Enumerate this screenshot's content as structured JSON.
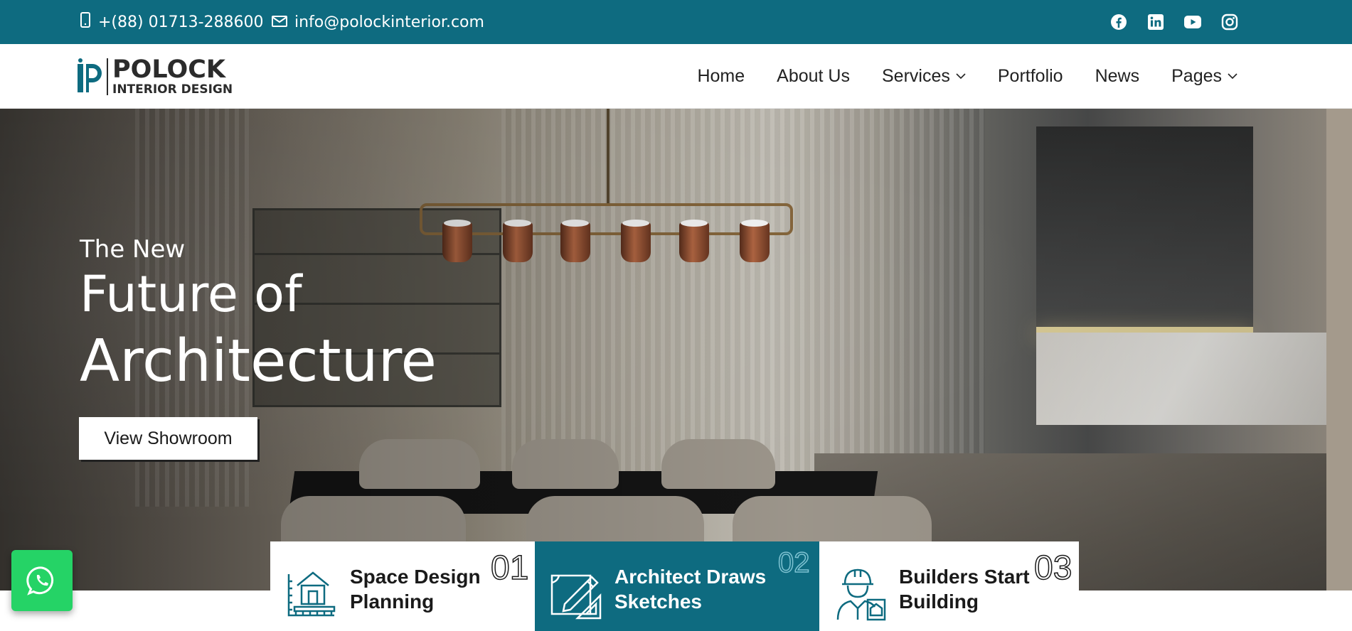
{
  "topbar": {
    "phone": "+(88) 01713-288600",
    "email": "info@polockinterior.com",
    "socials": [
      "facebook-icon",
      "linkedin-icon",
      "youtube-icon",
      "instagram-icon"
    ]
  },
  "brand": {
    "name": "POLOCK",
    "tagline": "INTERIOR DESIGN"
  },
  "nav": {
    "items": [
      {
        "label": "Home"
      },
      {
        "label": "About Us"
      },
      {
        "label": "Services"
      },
      {
        "label": "Portfolio"
      },
      {
        "label": "News"
      },
      {
        "label": "Pages"
      }
    ]
  },
  "hero": {
    "pre": "The New",
    "line1": "Future of",
    "line2": "Architecture",
    "cta": "View Showroom"
  },
  "cards": [
    {
      "title": "Space Design Planning",
      "number": "01",
      "icon": "house-blueprint-icon"
    },
    {
      "title": "Architect Draws Sketches",
      "number": "02",
      "icon": "pencil-drawing-icon"
    },
    {
      "title": "Builders Start Building",
      "number": "03",
      "icon": "builder-worker-icon"
    }
  ],
  "colors": {
    "brand": "#0e6b80",
    "whatsapp": "#25d366"
  }
}
